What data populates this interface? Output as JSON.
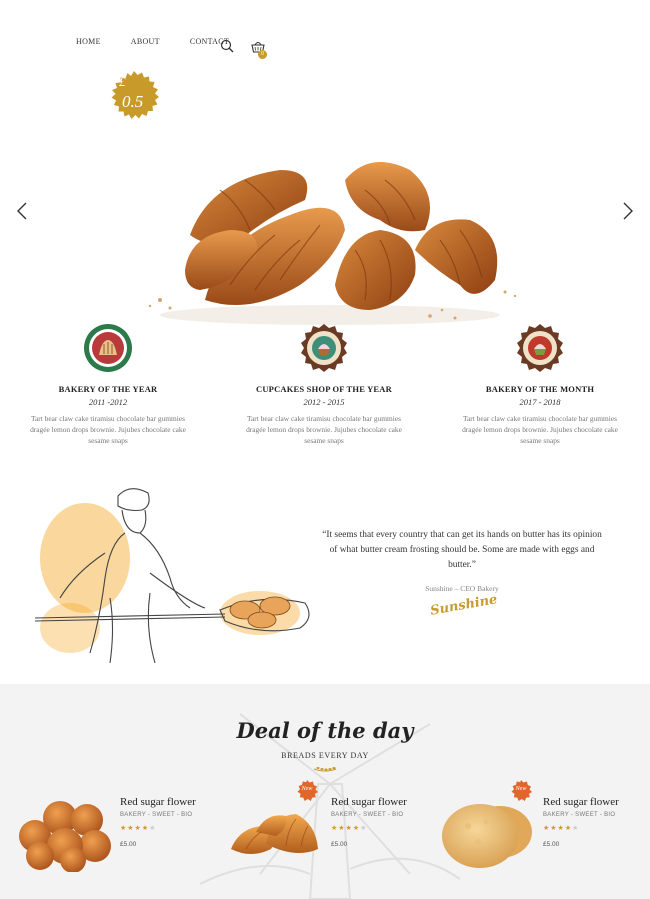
{
  "nav": {
    "items": [
      "HOME",
      "ABOUT",
      "CONTACT"
    ],
    "cart_count": "0"
  },
  "hero": {
    "price_currency": "£",
    "price_amount": "0.5"
  },
  "awards": [
    {
      "title": "BAKERY OF THE YEAR",
      "years": "2011 -2012",
      "text": "Tart bear claw cake tiramisu chocolate bar gummies dragée lemon drops brownie. Jujubes chocolate cake sesame snaps"
    },
    {
      "title": "CUPCAKES SHOP OF THE YEAR",
      "years": "2012 - 2015",
      "text": "Tart bear claw cake tiramisu chocolate bar gummies dragée lemon drops brownie. Jujubes chocolate cake sesame snaps"
    },
    {
      "title": "BAKERY OF THE MONTH",
      "years": "2017 - 2018",
      "text": "Tart bear claw cake tiramisu chocolate bar gummies dragée lemon drops brownie. Jujubes chocolate cake sesame snaps"
    }
  ],
  "quote": {
    "text": "“It seems that every country that can get its hands on butter has its opinion of what butter cream frosting should be. Some are made with eggs and butter.”",
    "author": "Sunshine – CEO Bakery",
    "signature": "Sunshine"
  },
  "deals": {
    "title": "Deal of the day",
    "subtitle": "BREADS EVERY DAY",
    "products": [
      {
        "name": "Red sugar flower",
        "categories": "BAKERY - SWEET - BIO",
        "rating": 4,
        "price": "£5.00",
        "is_new": false
      },
      {
        "name": "Red sugar flower",
        "categories": "BAKERY - SWEET - BIO",
        "rating": 4,
        "price": "£5.00",
        "is_new": true,
        "new_label": "New"
      },
      {
        "name": "Red sugar flower",
        "categories": "BAKERY - SWEET - BIO",
        "rating": 4,
        "price": "£5.00",
        "is_new": true,
        "new_label": "New"
      }
    ]
  },
  "colors": {
    "accent_gold": "#c79a2a",
    "badge_orange": "#e0662a",
    "deals_bg": "#f3f3f3"
  }
}
